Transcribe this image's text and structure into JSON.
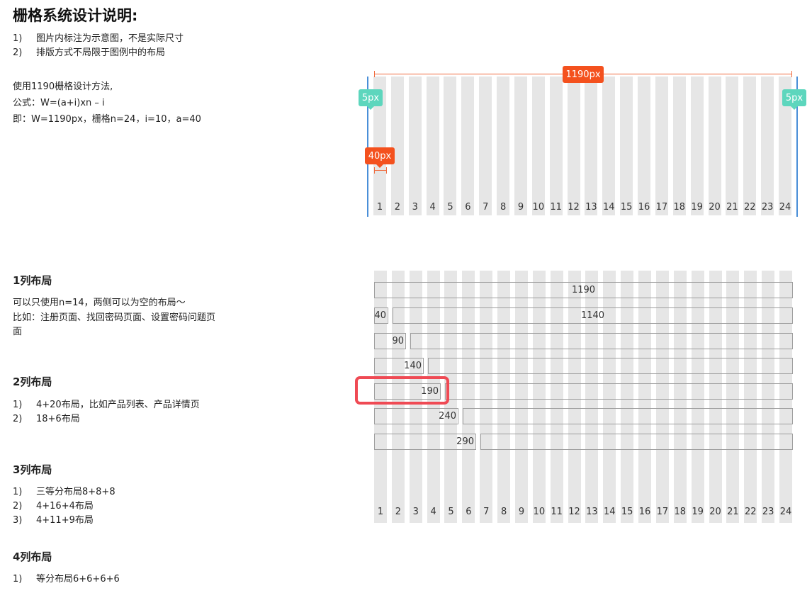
{
  "title": "栅格系统设计说明:",
  "notes": [
    {
      "num": "1)",
      "text": "图片内标注为示意图，不是实际尺寸"
    },
    {
      "num": "2)",
      "text": "排版方式不局限于图例中的布局"
    }
  ],
  "method": {
    "line1": "使用1190栅格设计方法,",
    "line2": "公式：W=(a+i)xn – i",
    "line3": "即：W=1190px，栅格n=24，i=10，a=40"
  },
  "sections": {
    "one": {
      "heading": "1列布局",
      "line1": "可以只使用n=14，两侧可以为空的布局～",
      "line2": "比如：注册页面、找回密码页面、设置密码问题页",
      "line3": "面"
    },
    "two": {
      "heading": "2列布局",
      "items": [
        {
          "num": "1)",
          "text": "4+20布局，比如产品列表、产品详情页"
        },
        {
          "num": "2)",
          "text": "18+6布局"
        }
      ]
    },
    "three": {
      "heading": "3列布局",
      "items": [
        {
          "num": "1)",
          "text": "三等分布局8+8+8"
        },
        {
          "num": "2)",
          "text": "4+16+4布局"
        },
        {
          "num": "3)",
          "text": "4+11+9布局"
        }
      ]
    },
    "four": {
      "heading": "4列布局",
      "items": [
        {
          "num": "1)",
          "text": "等分布局6+6+6+6"
        }
      ]
    }
  },
  "top_grid": {
    "column_labels": [
      "1",
      "2",
      "3",
      "4",
      "5",
      "6",
      "7",
      "8",
      "9",
      "10",
      "11",
      "12",
      "13",
      "14",
      "15",
      "16",
      "17",
      "18",
      "19",
      "20",
      "21",
      "22",
      "23",
      "24"
    ],
    "width_label": "1190px",
    "margin_label": "5px",
    "column_width_label": "40px"
  },
  "bottom_grid": {
    "column_labels": [
      "1",
      "2",
      "3",
      "4",
      "5",
      "6",
      "7",
      "8",
      "9",
      "10",
      "11",
      "12",
      "13",
      "14",
      "15",
      "16",
      "17",
      "18",
      "19",
      "20",
      "21",
      "22",
      "23",
      "24"
    ],
    "rows": [
      {
        "left": "1190",
        "right": ""
      },
      {
        "left": "40",
        "right": "1140"
      },
      {
        "left": "90",
        "right": ""
      },
      {
        "left": "140",
        "right": ""
      },
      {
        "left": "190",
        "right": ""
      },
      {
        "left": "240",
        "right": ""
      },
      {
        "left": "290",
        "right": ""
      }
    ],
    "highlighted_row_label": "190"
  },
  "colors": {
    "grid_column": "#e6e6e6",
    "badge_orange": "#f4511e",
    "badge_teal": "#5dd6bd",
    "edge_line": "#4a8fd8",
    "highlight": "#ef4a54",
    "bar_border": "#9e9e9e"
  }
}
